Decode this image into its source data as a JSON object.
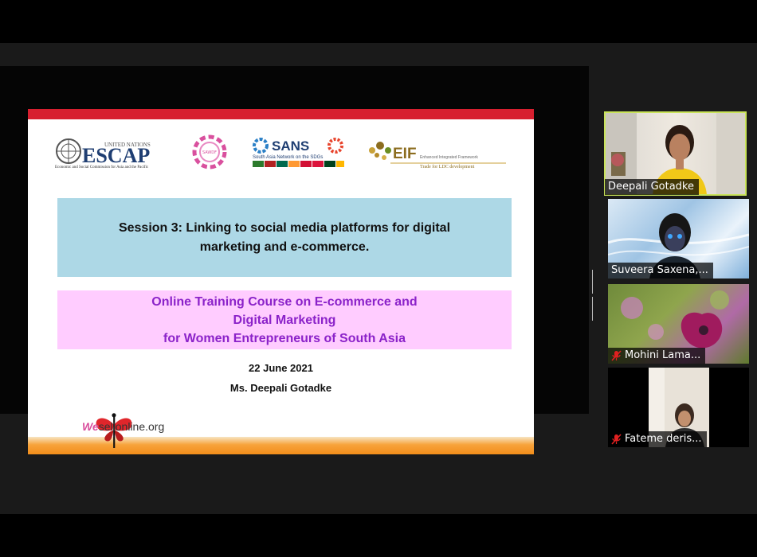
{
  "slide": {
    "logos": {
      "un_top": "UNITED NATIONS",
      "escap": "ESCAP",
      "escap_sub": "Economic and Social Commission for Asia and the Pacific",
      "sawdf": "SAWDF",
      "sans": "SANS",
      "sans_sub": "South Asia Network on the SDGs",
      "eif": "EIF",
      "eif_sub1": "Enhanced Integrated Framework",
      "eif_sub2": "Trade for LDC development"
    },
    "session_title": "Session 3: Linking to social media platforms for digital marketing and e-commerce.",
    "course_title": [
      "Online Training Course on E-commerce and",
      "Digital Marketing",
      "for Women Entrepreneurs of South Asia"
    ],
    "date": "22 June 2021",
    "presenter": "Ms. Deepali Gotadke",
    "footer_brand_prefix": "We",
    "footer_brand_suffix": "sellonline.org"
  },
  "participants": [
    {
      "name": "Deepali Gotadke",
      "muted": false,
      "active_speaker": true
    },
    {
      "name": "Suveera Saxena,...",
      "muted": false,
      "active_speaker": false
    },
    {
      "name": "Mohini Lama...",
      "muted": true,
      "active_speaker": false
    },
    {
      "name": "Fateme deris...",
      "muted": true,
      "active_speaker": false
    }
  ],
  "colors": {
    "slide_red_bar": "#d71f2f",
    "session_box": "#add8e6",
    "course_box": "#ffccff",
    "course_text": "#8b22c9",
    "active_speaker_border": "#c9e35a",
    "muted_icon": "#e02020"
  }
}
